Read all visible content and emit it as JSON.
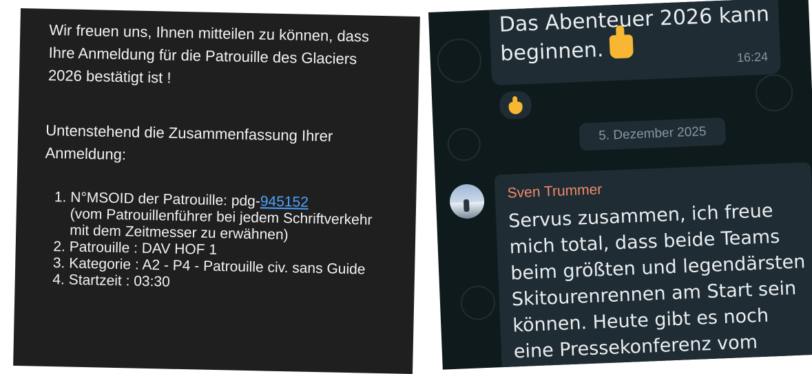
{
  "email": {
    "intro": "Wir freuen uns, Ihnen mitteilen zu können, dass Ihre Anmeldung für die Patrouille des Glaciers 2026 bestätigt ist !",
    "summary": "Untenstehend die Zusammenfassung Ihrer Anmeldung:",
    "items": {
      "msoid_prefix": "N°MSOID der Patrouille: pdg-",
      "msoid_link": "945152",
      "msoid_note": "(vom Patrouillenführer bei jedem Schriftverkehr mit dem Zeitmesser zu erwähnen)",
      "patrouille": "Patrouille : DAV HOF 1",
      "kategorie": "Kategorie : A2 - P4 - Patrouille civ. sans Guide",
      "startzeit": "Startzeit : 03:30"
    },
    "colors": {
      "background": "#1f1f1f",
      "text": "#f2f2f2",
      "link": "#4da3ff"
    }
  },
  "chat": {
    "outgoing": {
      "line1": "Das Abenteuer 2026 kann",
      "line2": "beginnen.",
      "emoji": "thumbs-up-icon",
      "time": "16:24"
    },
    "reaction": "thumbs-up-icon",
    "date_separator": "5. Dezember 2025",
    "incoming": {
      "sender": "Sven Trummer",
      "text": "Servus zusammen, ich freue mich total, dass beide Teams beim größten und legendärsten Skitourenrennen am Start sein können. Heute gibt es noch eine Pressekonferenz vom Kommandeur."
    },
    "colors": {
      "background": "#0f1a1d",
      "bubble": "#1f2c33",
      "sender": "#f08a6b",
      "meta": "#8696a0"
    }
  }
}
